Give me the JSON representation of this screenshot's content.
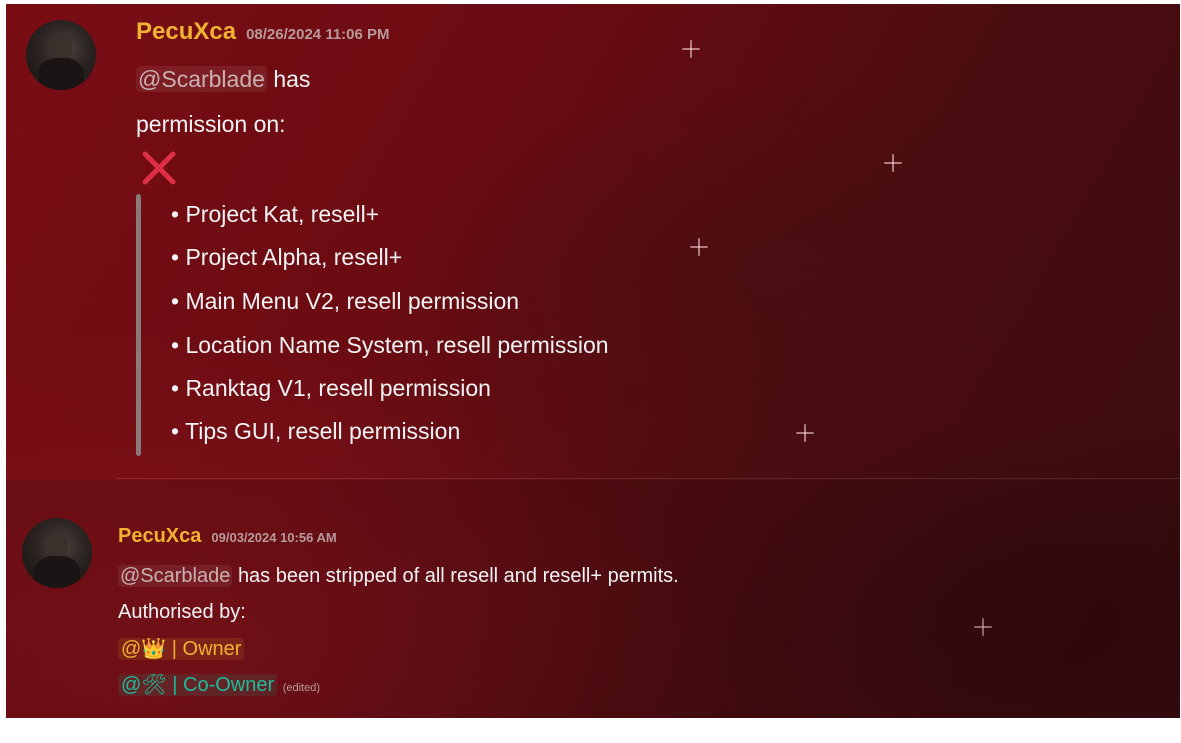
{
  "messages": [
    {
      "username": "PecuXca",
      "timestamp": "08/26/2024 11:06 PM",
      "mention": "@Scarblade",
      "line1_suffix": "has",
      "line2": "permission on:",
      "status_icon": "red-x-icon",
      "items": [
        "• Project Kat, resell+",
        "• Project Alpha, resell+",
        "• Main Menu V2, resell permission",
        "• Location Name System, resell permission",
        "• Ranktag V1, resell permission",
        "• Tips GUI, resell permission"
      ]
    },
    {
      "username": "PecuXca",
      "timestamp": "09/03/2024 10:56 AM",
      "mention": "@Scarblade",
      "line1_suffix": "has been stripped of all resell and resell+ permits.",
      "line2": "Authorised by:",
      "roles": [
        {
          "at": "@",
          "icon": "👑",
          "label": "| Owner",
          "color": "#f0b232"
        },
        {
          "at": "@",
          "icon": "🛠",
          "label": "| Co-Owner",
          "color": "#1abc9c"
        }
      ],
      "edited": "(edited)"
    }
  ],
  "colors": {
    "username": "#f0b232",
    "background": "#6a0c12",
    "text": "#f2f3f5",
    "quote_bar": "#8a7a7c"
  }
}
